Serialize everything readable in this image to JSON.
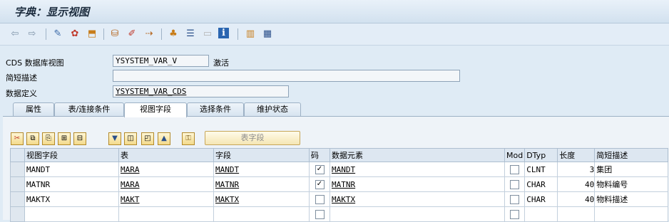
{
  "window": {
    "title": "字典：显示视图"
  },
  "toolbar": {
    "icons": [
      "back-icon",
      "forward-icon",
      "display-change-icon",
      "other-object-icon",
      "activate-icon",
      "where-used-icon",
      "edit-icon",
      "transport-icon",
      "hierarchy-icon",
      "documentation-icon",
      "display-icon",
      "info-icon",
      "technical-settings-icon",
      "table-view-icon"
    ]
  },
  "form": {
    "cds_label": "CDS 数据库视图",
    "cds_value": "YSYSTEM_VAR_V",
    "status": "激活",
    "desc_label": "简短描述",
    "desc_value": "",
    "def_label": "数据定义",
    "def_value": "YSYSTEM_VAR_CDS"
  },
  "tabs": [
    {
      "label": "属性"
    },
    {
      "label": "表/连接条件"
    },
    {
      "label": "视图字段",
      "active": true
    },
    {
      "label": "选择条件"
    },
    {
      "label": "维护状态"
    }
  ],
  "subtoolbar": {
    "table_field_button": "表字段"
  },
  "grid": {
    "columns": [
      "视图字段",
      "表",
      "字段",
      "码",
      "数据元素",
      "Mod",
      "DTyp",
      "长度",
      "简短描述"
    ],
    "rows": [
      {
        "view_field": "MANDT",
        "table": "MARA",
        "field": "MANDT",
        "key": true,
        "element": "MANDT",
        "mod": false,
        "dtyp": "CLNT",
        "length": "3",
        "desc": "集团"
      },
      {
        "view_field": "MATNR",
        "table": "MARA",
        "field": "MATNR",
        "key": true,
        "element": "MATNR",
        "mod": false,
        "dtyp": "CHAR",
        "length": "40",
        "desc": "物料编号"
      },
      {
        "view_field": "MAKTX",
        "table": "MAKT",
        "field": "MAKTX",
        "key": false,
        "element": "MAKTX",
        "mod": false,
        "dtyp": "CHAR",
        "length": "40",
        "desc": "物料描述"
      }
    ]
  }
}
